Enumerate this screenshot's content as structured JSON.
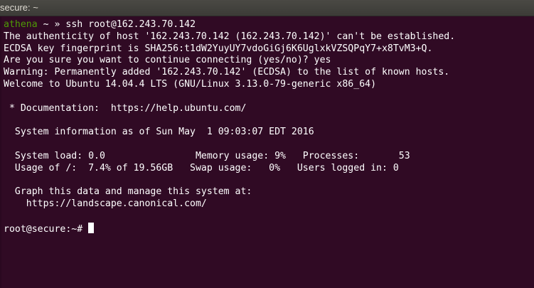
{
  "window": {
    "title": "secure: ~"
  },
  "prompt1": {
    "host": "athena",
    "path": "~",
    "arrow": "»",
    "command": "ssh root@162.243.70.142"
  },
  "output": [
    "The authenticity of host '162.243.70.142 (162.243.70.142)' can't be established.",
    "ECDSA key fingerprint is SHA256:t1dW2YuyUY7vdoGiGj6K6UglxkVZSQPqY7+x8TvM3+Q.",
    "Are you sure you want to continue connecting (yes/no)? yes",
    "Warning: Permanently added '162.243.70.142' (ECDSA) to the list of known hosts.",
    "Welcome to Ubuntu 14.04.4 LTS (GNU/Linux 3.13.0-79-generic x86_64)",
    "",
    " * Documentation:  https://help.ubuntu.com/",
    "",
    "  System information as of Sun May  1 09:03:07 EDT 2016",
    "",
    "  System load: 0.0                Memory usage: 9%   Processes:       53",
    "  Usage of /:  7.4% of 19.56GB   Swap usage:   0%   Users logged in: 0",
    "",
    "  Graph this data and manage this system at:",
    "    https://landscape.canonical.com/",
    ""
  ],
  "prompt2": {
    "text": "root@secure:~# "
  }
}
